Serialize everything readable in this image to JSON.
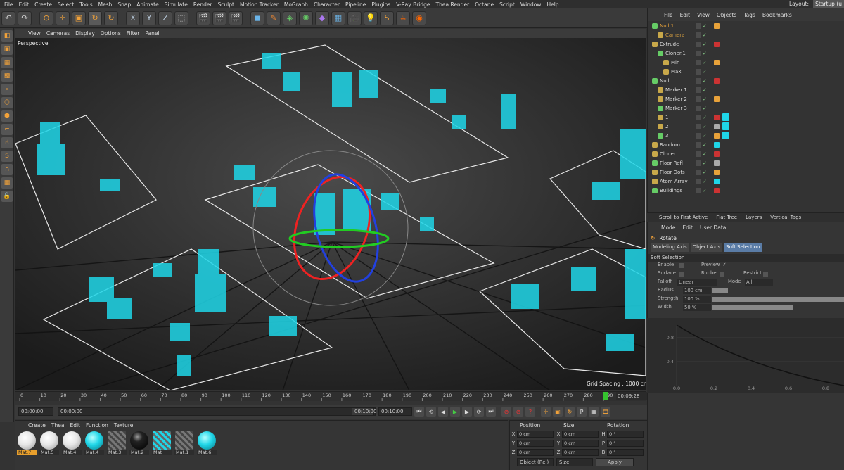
{
  "menu": [
    "File",
    "Edit",
    "Create",
    "Select",
    "Tools",
    "Mesh",
    "Snap",
    "Animate",
    "Simulate",
    "Render",
    "Sculpt",
    "Motion Tracker",
    "MoGraph",
    "Character",
    "Pipeline",
    "Plugins",
    "V-Ray Bridge",
    "Thea Render",
    "Octane",
    "Script",
    "Window",
    "Help"
  ],
  "layout_label": "Layout:",
  "layout_value": "Startup (u",
  "viewport": {
    "menu": [
      "View",
      "Cameras",
      "Display",
      "Options",
      "Filter",
      "Panel"
    ],
    "label": "Perspective",
    "grid_spacing": "Grid Spacing : 1000 cm"
  },
  "timeline": {
    "ticks": [
      "0",
      "10",
      "20",
      "30",
      "40",
      "50",
      "60",
      "70",
      "80",
      "90",
      "100",
      "110",
      "120",
      "130",
      "140",
      "150",
      "160",
      "170",
      "180",
      "190",
      "200",
      "210",
      "220",
      "230",
      "240",
      "250",
      "260",
      "270",
      "280",
      "290"
    ],
    "current_frame": "00:09:28",
    "start": "00:00:00",
    "min": "00:00:00",
    "max": "00:10:00",
    "end": "00:10:00"
  },
  "materials": {
    "menu": [
      "Create",
      "Thea",
      "Edit",
      "Function",
      "Texture"
    ],
    "items": [
      {
        "label": "Mat.7",
        "type": "white",
        "selected": true
      },
      {
        "label": "Mat.5",
        "type": "white",
        "selected": false
      },
      {
        "label": "Mat.4",
        "type": "white",
        "selected": false
      },
      {
        "label": "Mat.4",
        "type": "cyan",
        "selected": false
      },
      {
        "label": "Mat.3",
        "type": "hatch",
        "selected": false
      },
      {
        "label": "Mat.2",
        "type": "black",
        "selected": false
      },
      {
        "label": "Mat",
        "type": "hatchcyan",
        "selected": false
      },
      {
        "label": "Mat.1",
        "type": "hatch",
        "selected": false
      },
      {
        "label": "Mat.6",
        "type": "cyan",
        "selected": false
      }
    ]
  },
  "coords": {
    "headers": [
      "Position",
      "Size",
      "Rotation"
    ],
    "rows": [
      {
        "axis": "X",
        "pos": "0 cm",
        "sizeaxis": "X",
        "size": "0 cm",
        "rotaxis": "H",
        "rot": "0 °"
      },
      {
        "axis": "Y",
        "pos": "0 cm",
        "sizeaxis": "Y",
        "size": "0 cm",
        "rotaxis": "P",
        "rot": "0 °"
      },
      {
        "axis": "Z",
        "pos": "0 cm",
        "sizeaxis": "Z",
        "size": "0 cm",
        "rotaxis": "B",
        "rot": "0 °"
      }
    ],
    "mode": "Object (Rel)",
    "size_mode": "Size",
    "apply": "Apply"
  },
  "objects": {
    "menu": [
      "File",
      "Edit",
      "View",
      "Objects",
      "Tags",
      "Bookmarks"
    ],
    "rows": [
      {
        "name": "Null.1",
        "indent": 0,
        "color": "#e8a23a"
      },
      {
        "name": "Camera",
        "indent": 1,
        "color": "#d8a040"
      },
      {
        "name": "Extrude",
        "indent": 0,
        "color": "#ddd"
      },
      {
        "name": "Cloner.1",
        "indent": 1,
        "color": "#ddd"
      },
      {
        "name": "Min",
        "indent": 2,
        "color": "#ddd"
      },
      {
        "name": "Max",
        "indent": 2,
        "color": "#ddd"
      },
      {
        "name": "Null",
        "indent": 0,
        "color": "#ddd"
      },
      {
        "name": "Marker 1",
        "indent": 1,
        "color": "#ddd"
      },
      {
        "name": "Marker 2",
        "indent": 1,
        "color": "#ddd"
      },
      {
        "name": "Marker 3",
        "indent": 1,
        "color": "#ddd"
      },
      {
        "name": "1",
        "indent": 1,
        "color": "#ddd"
      },
      {
        "name": "2",
        "indent": 1,
        "color": "#ddd"
      },
      {
        "name": "3",
        "indent": 1,
        "color": "#ddd"
      },
      {
        "name": "Random",
        "indent": 0,
        "color": "#ddd"
      },
      {
        "name": "Cloner",
        "indent": 0,
        "color": "#ddd"
      },
      {
        "name": "Floor Refl",
        "indent": 0,
        "color": "#ddd"
      },
      {
        "name": "Floor Dots",
        "indent": 0,
        "color": "#ddd"
      },
      {
        "name": "Atom Array",
        "indent": 0,
        "color": "#ddd"
      },
      {
        "name": "Buildings",
        "indent": 0,
        "color": "#ddd"
      }
    ],
    "tabs": [
      "Scroll to First Active",
      "Flat Tree",
      "Layers",
      "Vertical Tags"
    ]
  },
  "attributes": {
    "menu": [
      "Mode",
      "Edit",
      "User Data"
    ],
    "title": "Rotate",
    "tabs": [
      {
        "label": "Modeling Axis",
        "active": false
      },
      {
        "label": "Object Axis",
        "active": false
      },
      {
        "label": "Soft Selection",
        "active": true
      }
    ],
    "section": "Soft Selection",
    "enable": "Enable",
    "preview": "Preview",
    "surface": "Surface",
    "rubber": "Rubber",
    "restrict": "Restrict",
    "falloff": "Falloff",
    "falloff_val": "Linear",
    "mode": "Mode",
    "mode_val": "All",
    "radius": "Radius",
    "radius_val": "100 cm",
    "strength": "Strength",
    "strength_val": "100 %",
    "width": "Width",
    "width_val": "50 %",
    "graph_y": [
      "0.8",
      "0.4"
    ],
    "graph_x": [
      "0.0",
      "0.2",
      "0.4",
      "0.6",
      "0.8"
    ]
  }
}
